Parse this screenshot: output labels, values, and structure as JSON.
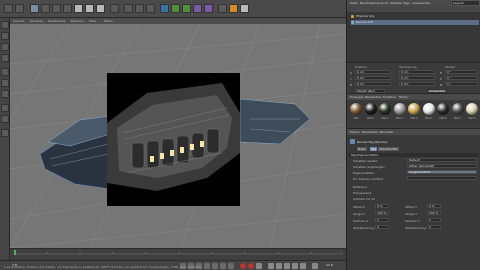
{
  "right_menu": {
    "items": [
      "Datei",
      "Bearbeiten",
      "Ansicht",
      "Objekte",
      "Tags",
      "Lesezeichen"
    ],
    "layout": "Layout:"
  },
  "object_manager": {
    "rows": [
      {
        "label": "Physical Sky"
      },
      {
        "label": "Raumschiff",
        "selected": true
      }
    ]
  },
  "coordinates": {
    "headers": [
      "Position",
      "Abmessung",
      "Winkel"
    ],
    "rows": [
      {
        "axis": "X",
        "pos": "0 cm",
        "size": "0 cm",
        "angle_axis": "H",
        "angle": "0 °"
      },
      {
        "axis": "Y",
        "pos": "0 cm",
        "size": "0 cm",
        "angle_axis": "P",
        "angle": "0 °"
      },
      {
        "axis": "Z",
        "pos": "0 cm",
        "size": "0 cm",
        "angle_axis": "B",
        "angle": "0 °"
      }
    ],
    "mode": "Objekt (Rel)",
    "apply": "Anwenden"
  },
  "materials": {
    "menu": [
      "Erzeugen",
      "Bearbeiten",
      "Funktion",
      "Textur"
    ],
    "balls": [
      {
        "label": "Mat",
        "color": "#7b5a35"
      },
      {
        "label": "Mat.1",
        "color": "#1e1e1e"
      },
      {
        "label": "Mat.2",
        "color": "#26331f"
      },
      {
        "label": "Mat.3",
        "color": "#9a9a9a"
      },
      {
        "label": "Mat.4",
        "color": "#c9a54a"
      },
      {
        "label": "Mat.5",
        "color": "#e8e8e8"
      },
      {
        "label": "Mat.6",
        "color": "#2b2b2b"
      },
      {
        "label": "Mat.7",
        "color": "#4c4c4c"
      },
      {
        "label": "Mat.8",
        "color": "#d9d0b3"
      }
    ]
  },
  "attributes": {
    "menu": [
      "Modus",
      "Bearbeiten",
      "Benutzer"
    ],
    "title": "Render-Tag [Render]",
    "tabs": [
      "Basis",
      "Tag",
      "Objektbuffer"
    ],
    "section": "Tag-Eigenschaften",
    "props": [
      {
        "label": "Schatten werfen",
        "value": "Default"
      },
      {
        "label": "Schatten empfangen",
        "value": "Gitter (Komplett)"
      },
      {
        "label": "Eigenschatten",
        "value": "Ausgeschaltet"
      },
      {
        "label": "Für Kamera sichtbar",
        "value": ""
      }
    ],
    "checks": [
      "Reflexion",
      "Transparenz",
      "Sichtbar für GI"
    ],
    "num_rows": [
      {
        "a_label": "Offset U",
        "a": "0 %",
        "b_label": "Offset V",
        "b": "0 %"
      },
      {
        "a_label": "Länge U",
        "a": "100 %",
        "b_label": "Länge V",
        "b": "100 %"
      },
      {
        "a_label": "Kacheln U",
        "a": "1",
        "b_label": "Kacheln V",
        "b": "1"
      },
      {
        "a_label": "Wiederholung U",
        "a": "0",
        "b_label": "Wiederholung V",
        "b": "0"
      }
    ]
  },
  "viewport": {
    "menu": [
      "Ansicht",
      "Kameras",
      "Darstellung",
      "Optionen",
      "Filter",
      "Tafeln"
    ]
  },
  "status": {
    "text": "Live-Selektion: Klicken und ziehen, um Elemente zu selektieren. SHIFT drücken, um Selektionen hinzuzufügen, CTRL zum Abziehen."
  },
  "timeline": {
    "start": "0 B",
    "end": "90 B"
  }
}
